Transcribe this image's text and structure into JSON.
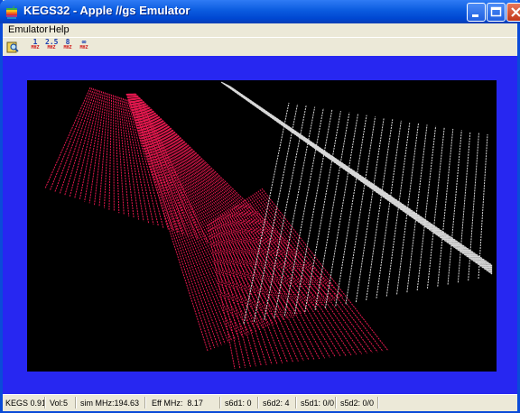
{
  "window": {
    "title": "KEGS32 - Apple //gs Emulator"
  },
  "menu": {
    "items": [
      "Emulator",
      "Help"
    ]
  },
  "toolbar": {
    "speeds": [
      {
        "value": "1",
        "unit": "MHZ"
      },
      {
        "value": "2.5",
        "unit": "MHZ"
      },
      {
        "value": "8",
        "unit": "MHZ"
      },
      {
        "value": "∞",
        "unit": "MHZ"
      }
    ]
  },
  "colors": {
    "screen_background": "#000000",
    "border": "#2727f1",
    "line_red": "#e4194f",
    "line_white": "#d8d8d8"
  },
  "status": {
    "fields": [
      "KEGS 0.91",
      "Vol:5",
      "sim MHz:194.63",
      "Eff MHz:  8.17",
      "s6d1: 0",
      "s6d2: 4",
      "s5d1: 0/0",
      "s5d2: 0/0"
    ]
  }
}
